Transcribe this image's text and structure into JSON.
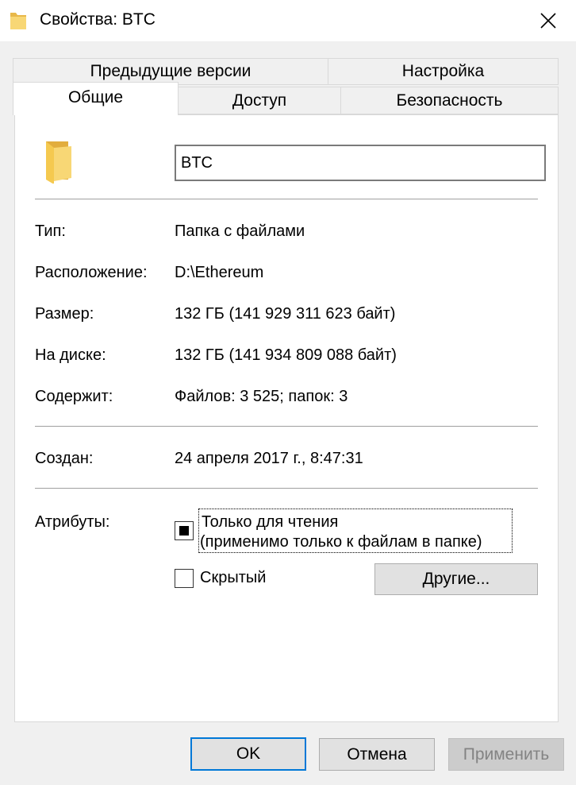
{
  "window": {
    "title": "Свойства: BTC"
  },
  "tabs": {
    "previous_versions": "Предыдущие версии",
    "customize": "Настройка",
    "general": "Общие",
    "sharing": "Доступ",
    "security": "Безопасность"
  },
  "general": {
    "folder_name": "BTC",
    "type_label": "Тип:",
    "type_value": "Папка с файлами",
    "location_label": "Расположение:",
    "location_value": "D:\\Ethereum",
    "size_label": "Размер:",
    "size_value": "132 ГБ (141 929 311 623 байт)",
    "size_on_disk_label": "На диске:",
    "size_on_disk_value": "132 ГБ (141 934 809 088 байт)",
    "contains_label": "Содержит:",
    "contains_value": "Файлов: 3 525; папок: 3",
    "created_label": "Создан:",
    "created_value": "24 апреля 2017 г., 8:47:31",
    "attributes_label": "Атрибуты:",
    "readonly_line1": "Только для чтения",
    "readonly_line2": "(применимо только к файлам в папке)",
    "readonly_state": "indeterminate",
    "hidden_label": "Скрытый",
    "hidden_checked": false,
    "advanced_button": "Другие..."
  },
  "footer": {
    "ok": "OK",
    "cancel": "Отмена",
    "apply": "Применить"
  },
  "icons": {
    "folder": "folder-icon",
    "close": "close-icon"
  },
  "colors": {
    "accent": "#0078d7",
    "folder_yellow": "#f8d775"
  }
}
